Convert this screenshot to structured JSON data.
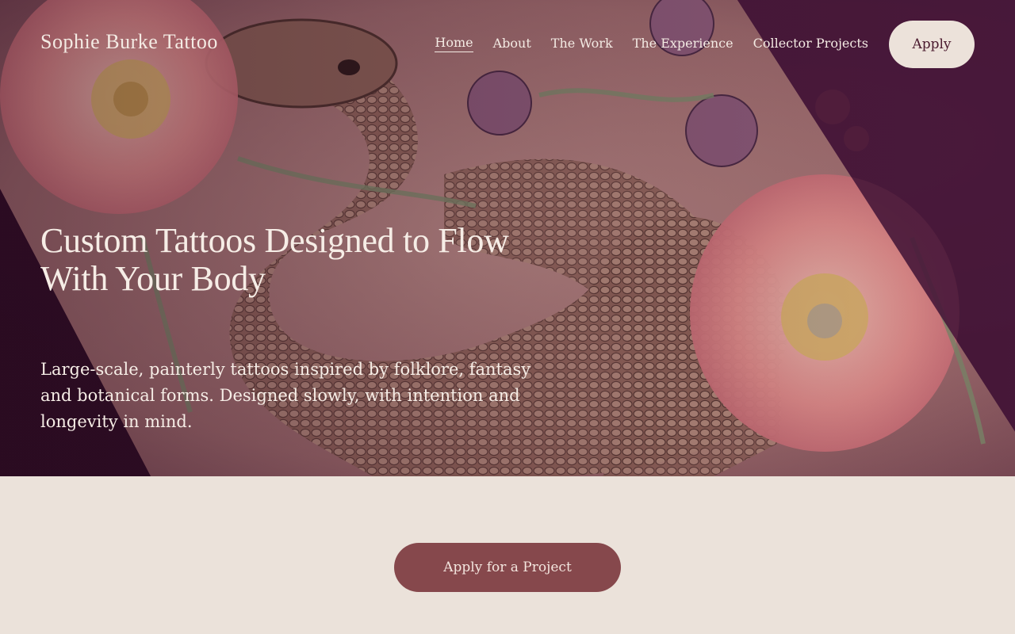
{
  "header": {
    "brand": "Sophie Burke Tattoo",
    "nav": [
      {
        "label": "Home",
        "active": true
      },
      {
        "label": "About"
      },
      {
        "label": "The Work"
      },
      {
        "label": "The Experience"
      },
      {
        "label": "Collector Projects"
      }
    ],
    "apply_label": "Apply"
  },
  "hero": {
    "headline": "Custom Tattoos Designed to Flow With Your Body",
    "subtext": "Large-scale, painterly tattoos inspired by folklore, fantasy and botanical forms. Designed slowly, with intention and longevity in mind."
  },
  "cta": {
    "label": "Apply for a Project"
  },
  "colors": {
    "hero_bg": "#3a1230",
    "page_bg": "#ebe2da",
    "cta_bg": "#86484c",
    "apply_bg": "#ece2da"
  }
}
